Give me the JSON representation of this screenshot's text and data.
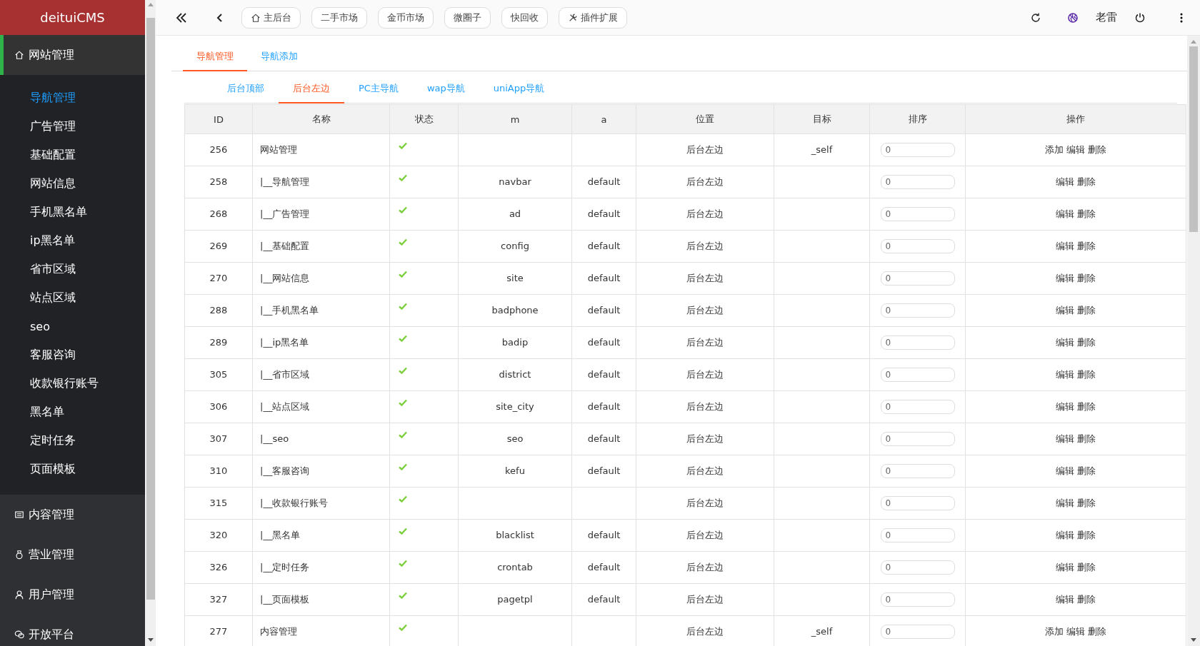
{
  "sidebar": {
    "logo": "deituiCMS",
    "groups": [
      {
        "label": "网站管理",
        "expanded": true,
        "children": [
          {
            "label": "导航管理",
            "selected": true
          },
          {
            "label": "广告管理",
            "selected": false
          },
          {
            "label": "基础配置",
            "selected": false
          },
          {
            "label": "网站信息",
            "selected": false
          },
          {
            "label": "手机黑名单",
            "selected": false
          },
          {
            "label": "ip黑名单",
            "selected": false
          },
          {
            "label": "省市区域",
            "selected": false
          },
          {
            "label": "站点区域",
            "selected": false
          },
          {
            "label": "seo",
            "selected": false
          },
          {
            "label": "客服咨询",
            "selected": false
          },
          {
            "label": "收款银行账号",
            "selected": false
          },
          {
            "label": "黑名单",
            "selected": false
          },
          {
            "label": "定时任务",
            "selected": false
          },
          {
            "label": "页面模板",
            "selected": false
          }
        ]
      },
      {
        "label": "内容管理",
        "expanded": false
      },
      {
        "label": "营业管理",
        "expanded": false
      },
      {
        "label": "用户管理",
        "expanded": false
      },
      {
        "label": "开放平台",
        "expanded": false
      }
    ]
  },
  "topbar": {
    "shortcuts": [
      {
        "label": "主后台"
      },
      {
        "label": "二手市场"
      },
      {
        "label": "金币市场"
      },
      {
        "label": "微圈子"
      },
      {
        "label": "快回收"
      },
      {
        "label": "插件扩展"
      }
    ],
    "user": "老雷"
  },
  "tabs": [
    {
      "label": "导航管理",
      "selected": true
    },
    {
      "label": "导航添加",
      "selected": false
    }
  ],
  "subtabs": [
    {
      "label": "后台顶部",
      "selected": false
    },
    {
      "label": "后台左边",
      "selected": true
    },
    {
      "label": "PC主导航",
      "selected": false
    },
    {
      "label": "wap导航",
      "selected": false
    },
    {
      "label": "uniApp导航",
      "selected": false
    }
  ],
  "table": {
    "columns": [
      "ID",
      "名称",
      "状态",
      "m",
      "a",
      "位置",
      "目标",
      "排序",
      "操作"
    ],
    "rows": [
      {
        "id": "256",
        "name": "网站管理",
        "enabled": true,
        "m": "",
        "a": "",
        "position": "后台左边",
        "target": "_self",
        "order": "0",
        "actions": [
          "添加",
          "编辑",
          "删除"
        ]
      },
      {
        "id": "258",
        "name": "|__导航管理",
        "enabled": true,
        "m": "navbar",
        "a": "default",
        "position": "后台左边",
        "target": "",
        "order": "0",
        "actions": [
          "编辑",
          "删除"
        ]
      },
      {
        "id": "268",
        "name": "|__广告管理",
        "enabled": true,
        "m": "ad",
        "a": "default",
        "position": "后台左边",
        "target": "",
        "order": "0",
        "actions": [
          "编辑",
          "删除"
        ]
      },
      {
        "id": "269",
        "name": "|__基础配置",
        "enabled": true,
        "m": "config",
        "a": "default",
        "position": "后台左边",
        "target": "",
        "order": "0",
        "actions": [
          "编辑",
          "删除"
        ]
      },
      {
        "id": "270",
        "name": "|__网站信息",
        "enabled": true,
        "m": "site",
        "a": "default",
        "position": "后台左边",
        "target": "",
        "order": "0",
        "actions": [
          "编辑",
          "删除"
        ]
      },
      {
        "id": "288",
        "name": "|__手机黑名单",
        "enabled": true,
        "m": "badphone",
        "a": "default",
        "position": "后台左边",
        "target": "",
        "order": "0",
        "actions": [
          "编辑",
          "删除"
        ]
      },
      {
        "id": "289",
        "name": "|__ip黑名单",
        "enabled": true,
        "m": "badip",
        "a": "default",
        "position": "后台左边",
        "target": "",
        "order": "0",
        "actions": [
          "编辑",
          "删除"
        ]
      },
      {
        "id": "305",
        "name": "|__省市区域",
        "enabled": true,
        "m": "district",
        "a": "default",
        "position": "后台左边",
        "target": "",
        "order": "0",
        "actions": [
          "编辑",
          "删除"
        ]
      },
      {
        "id": "306",
        "name": "|__站点区域",
        "enabled": true,
        "m": "site_city",
        "a": "default",
        "position": "后台左边",
        "target": "",
        "order": "0",
        "actions": [
          "编辑",
          "删除"
        ]
      },
      {
        "id": "307",
        "name": "|__seo",
        "enabled": true,
        "m": "seo",
        "a": "default",
        "position": "后台左边",
        "target": "",
        "order": "0",
        "actions": [
          "编辑",
          "删除"
        ]
      },
      {
        "id": "310",
        "name": "|__客服咨询",
        "enabled": true,
        "m": "kefu",
        "a": "default",
        "position": "后台左边",
        "target": "",
        "order": "0",
        "actions": [
          "编辑",
          "删除"
        ]
      },
      {
        "id": "315",
        "name": "|__收款银行账号",
        "enabled": true,
        "m": "",
        "a": "",
        "position": "后台左边",
        "target": "",
        "order": "0",
        "actions": [
          "编辑",
          "删除"
        ]
      },
      {
        "id": "320",
        "name": "|__黑名单",
        "enabled": true,
        "m": "blacklist",
        "a": "default",
        "position": "后台左边",
        "target": "",
        "order": "0",
        "actions": [
          "编辑",
          "删除"
        ]
      },
      {
        "id": "326",
        "name": "|__定时任务",
        "enabled": true,
        "m": "crontab",
        "a": "default",
        "position": "后台左边",
        "target": "",
        "order": "0",
        "actions": [
          "编辑",
          "删除"
        ]
      },
      {
        "id": "327",
        "name": "|__页面模板",
        "enabled": true,
        "m": "pagetpl",
        "a": "default",
        "position": "后台左边",
        "target": "",
        "order": "0",
        "actions": [
          "编辑",
          "删除"
        ]
      },
      {
        "id": "277",
        "name": "内容管理",
        "enabled": true,
        "m": "",
        "a": "",
        "position": "后台左边",
        "target": "_self",
        "order": "0",
        "actions": [
          "添加",
          "编辑",
          "删除"
        ]
      }
    ]
  }
}
